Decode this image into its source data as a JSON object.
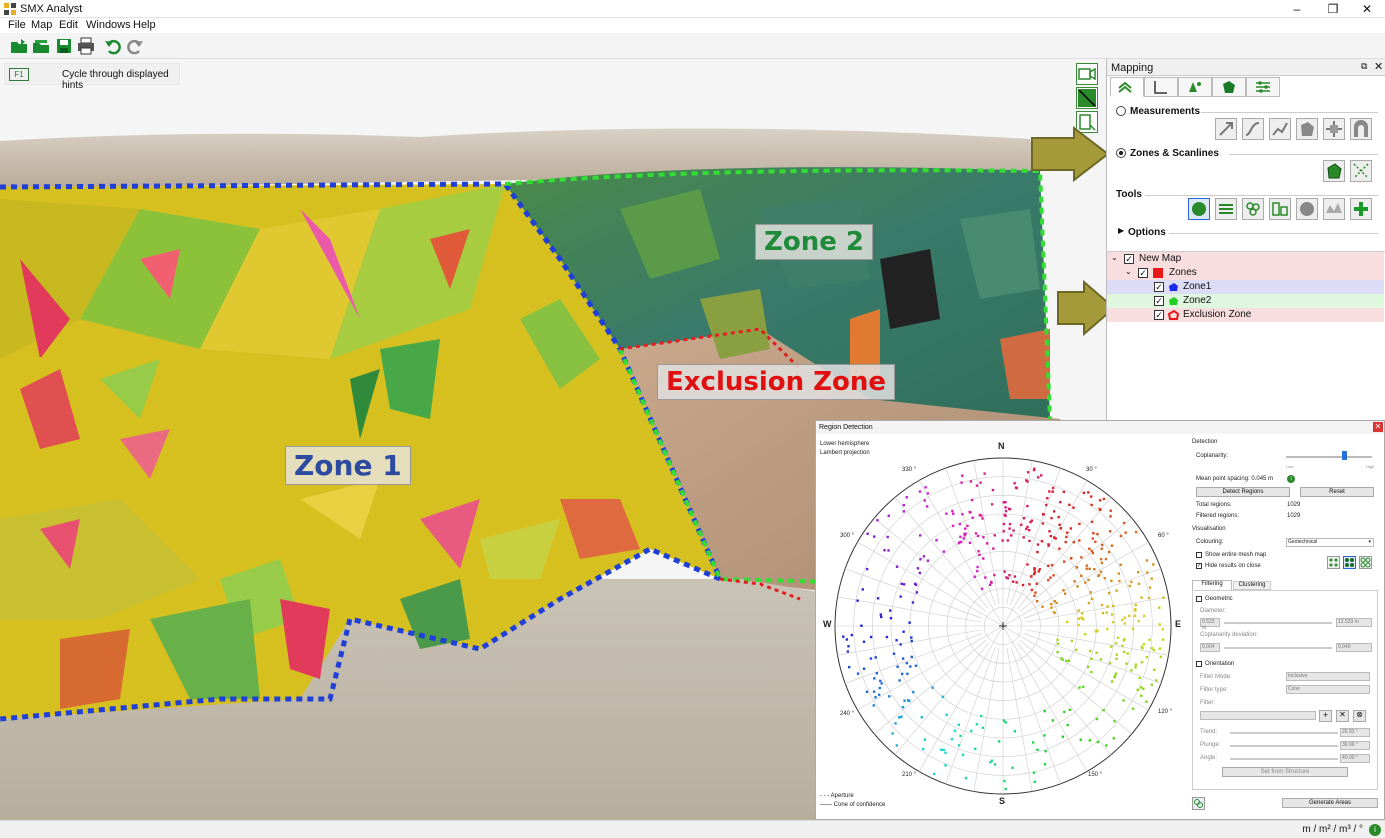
{
  "window": {
    "title": "SMX Analyst",
    "minimize": "–",
    "maximize": "❐",
    "close": "✕"
  },
  "menu": [
    "File",
    "Map",
    "Edit",
    "Windows",
    "Help"
  ],
  "toolbar": [
    "open-folder",
    "open-project",
    "save",
    "print",
    "undo",
    "redo"
  ],
  "hint": {
    "key": "F1",
    "text": "Cycle through displayed hints"
  },
  "viewport": {
    "labels": {
      "zone1": "Zone 1",
      "zone2": "Zone 2",
      "exclusion": "Exclusion Zone"
    },
    "colors": {
      "zone1_boundary": "#1f3fd8",
      "zone2_boundary": "#33dd33",
      "exclusion_boundary": "#e02020",
      "zone1_text": "#2b4aa0",
      "zone2_text": "#1e8a3a",
      "exclusion_text": "#e01010"
    }
  },
  "mapping": {
    "title": "Mapping",
    "measurements": "Measurements",
    "zones": "Zones & Scanlines",
    "tools": "Tools",
    "options": "Options",
    "tree": [
      {
        "label": "New Map",
        "level": 0,
        "checked": true,
        "icon": "map",
        "bg": "#f8dede"
      },
      {
        "label": "Zones",
        "level": 1,
        "checked": true,
        "icon": "red-square",
        "bg": "#f8dede"
      },
      {
        "label": "Zone1",
        "level": 2,
        "checked": true,
        "icon": "blue-polygon",
        "bg": "#dcdcf6"
      },
      {
        "label": "Zone2",
        "level": 2,
        "checked": true,
        "icon": "green-polygon",
        "bg": "#dff6df"
      },
      {
        "label": "Exclusion Zone",
        "level": 2,
        "checked": true,
        "icon": "red-polygon",
        "bg": "#f8dede"
      }
    ]
  },
  "region_detection": {
    "title": "Region Detection",
    "projection_line1": "Lower hemisphere",
    "projection_line2": "Lambert projection",
    "compass": {
      "N": "N",
      "S": "S",
      "E": "E",
      "W": "W"
    },
    "azimuth_labels": [
      "30 °",
      "60 °",
      "120 °",
      "150 °",
      "210 °",
      "240 °",
      "300 °",
      "330 °"
    ],
    "legend": [
      "Aperture",
      "Cone of confidence"
    ],
    "detection": "Detection",
    "coplanarity": "Coplanarity:",
    "low": "Low",
    "high": "High",
    "slider_value": 0.68,
    "mean_spacing": "Mean point spacing: 0.045 m",
    "detect_regions": "Detect Regions",
    "reset": "Reset",
    "total_regions_label": "Total regions:",
    "total_regions": "1029",
    "filtered_regions_label": "Filtered regions:",
    "filtered_regions": "1029",
    "visualisation": "Visualisation",
    "colouring_label": "Colouring:",
    "colouring_value": "Geotechnical",
    "show_mesh": "Show entire mesh map",
    "hide_results": "Hide results on close",
    "tab_filtering": "Filtering",
    "tab_clustering": "Clustering",
    "geometric": "Geometric",
    "diameter_label": "Diameter:",
    "diameter_min": "0.523 m",
    "diameter_max": "12.533 m",
    "coplanarity_dev_label": "Coplanarity deviation:",
    "coplanarity_min": "0.004",
    "coplanarity_max": "0.040",
    "orientation": "Orientation",
    "filter_mode_label": "Filter Mode:",
    "filter_mode_value": "Inclusive",
    "filter_type_label": "Filter type:",
    "filter_type_value": "Cone",
    "filter_label": "Filter:",
    "trend_label": "Trend:",
    "trend_value": "26.83 °",
    "plunge_label": "Plunge:",
    "plunge_value": "36.96 °",
    "angle_label": "Angle:",
    "angle_value": "40.00 °",
    "set_from_structure": "Set from Structure",
    "generate_areas": "Generate Areas"
  },
  "status": {
    "units": "m / m² / m³ / °"
  }
}
